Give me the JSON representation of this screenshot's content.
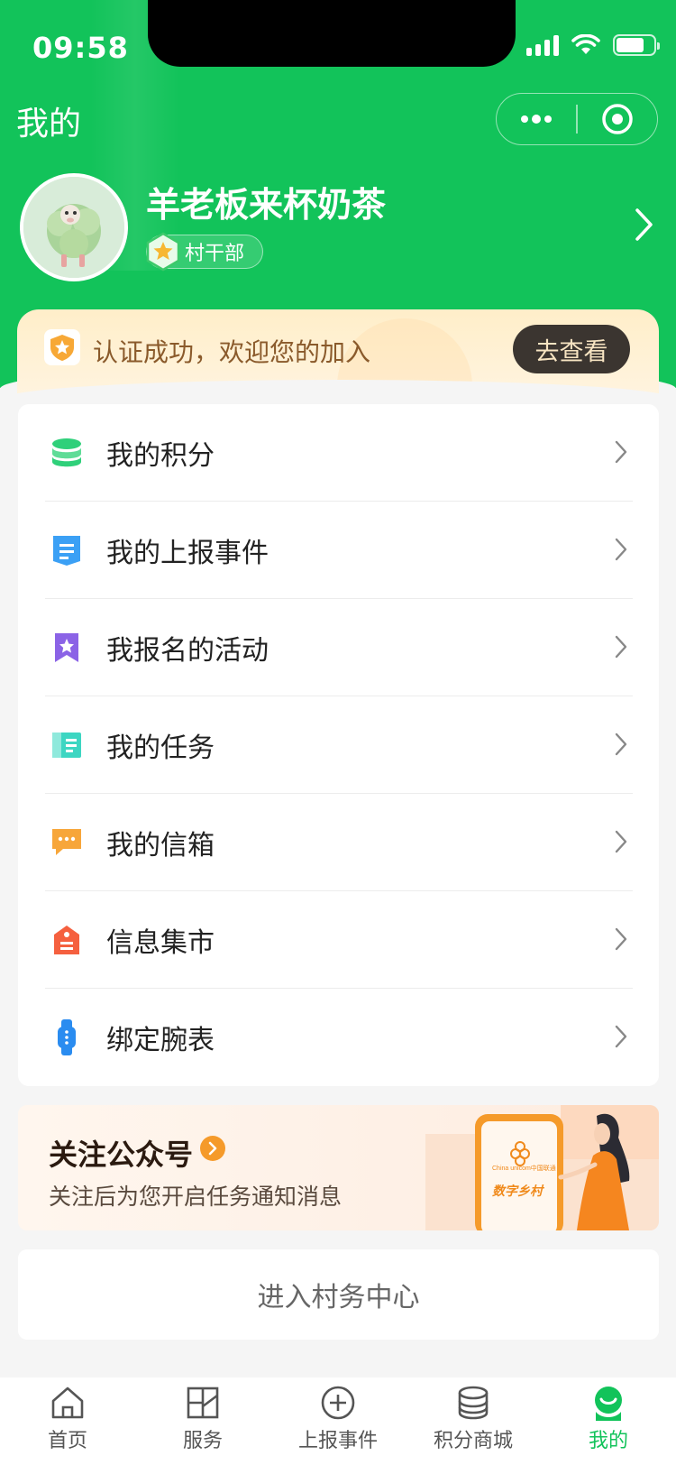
{
  "status_bar": {
    "time": "09:58",
    "battery_level": 0.75
  },
  "nav": {
    "title": "我的"
  },
  "profile": {
    "name": "羊老板来杯奶茶",
    "role": "村干部"
  },
  "cert_banner": {
    "text": "认证成功，欢迎您的加入",
    "button": "去查看"
  },
  "menu": {
    "items": [
      {
        "label": "我的积分",
        "icon": "points-stack-icon",
        "color": "#2fd07a"
      },
      {
        "label": "我的上报事件",
        "icon": "report-doc-icon",
        "color": "#3ba0f5"
      },
      {
        "label": "我报名的活动",
        "icon": "bookmark-star-icon",
        "color": "#8b63e6"
      },
      {
        "label": "我的任务",
        "icon": "task-book-icon",
        "color": "#3dd6c2"
      },
      {
        "label": "我的信箱",
        "icon": "message-bubble-icon",
        "color": "#f7a63a"
      },
      {
        "label": "信息集市",
        "icon": "market-tag-icon",
        "color": "#f5603f"
      },
      {
        "label": "绑定腕表",
        "icon": "watch-icon",
        "color": "#2a8cf0"
      }
    ]
  },
  "follow_banner": {
    "title": "关注公众号",
    "subtitle": "关注后为您开启任务通知消息",
    "art_brand": "China unicom中国联通",
    "art_caption": "数字乡村"
  },
  "village_center": {
    "label": "进入村务中心"
  },
  "tabbar": {
    "active": 4,
    "active_color": "#12c35a",
    "items": [
      {
        "label": "首页",
        "icon": "home-icon"
      },
      {
        "label": "服务",
        "icon": "service-grid-icon"
      },
      {
        "label": "上报事件",
        "icon": "plus-circle-icon"
      },
      {
        "label": "积分商城",
        "icon": "points-mall-icon"
      },
      {
        "label": "我的",
        "icon": "profile-icon"
      }
    ]
  }
}
